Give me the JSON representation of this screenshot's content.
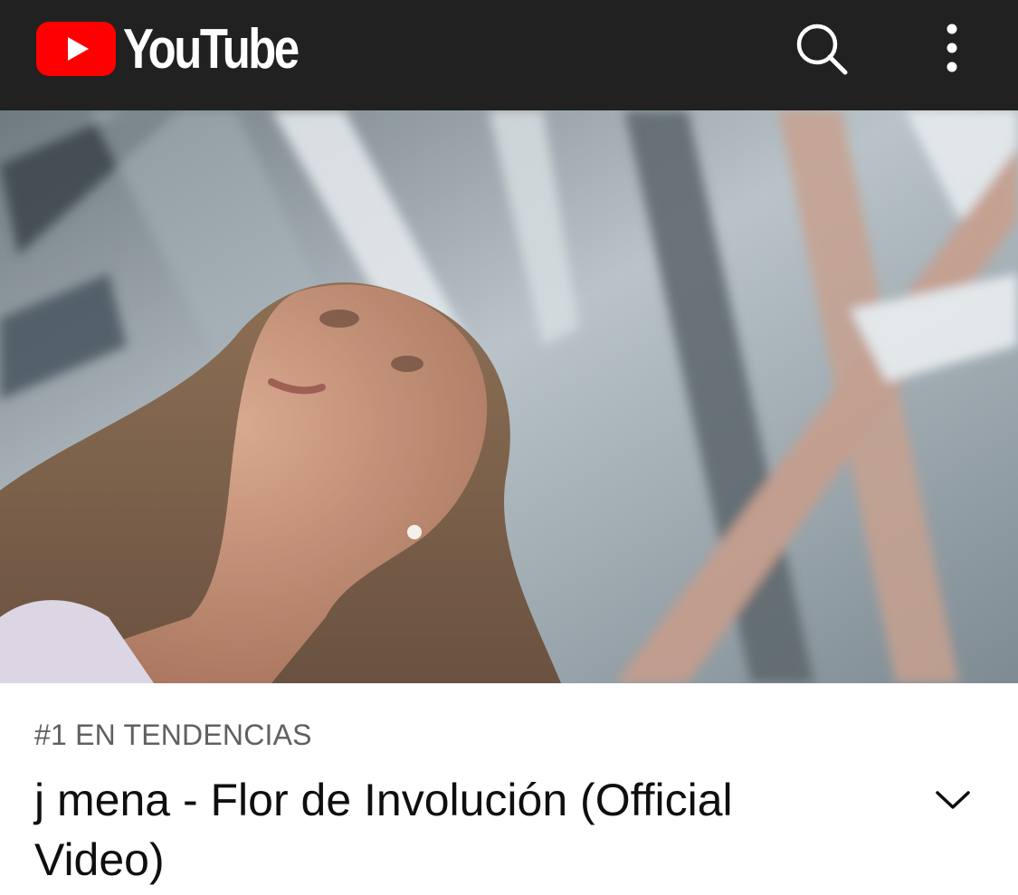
{
  "app": {
    "brand": "YouTube",
    "brand_color": "#ff0000",
    "header_bg": "#212121",
    "icons": {
      "logo": "youtube-play-icon",
      "search": "search-icon",
      "menu": "more-vert-icon",
      "expand": "chevron-down-icon"
    }
  },
  "video": {
    "trending_label": "#1 EN TENDENCIAS",
    "title": "j mena - Flor de Involución (Official Video)"
  }
}
